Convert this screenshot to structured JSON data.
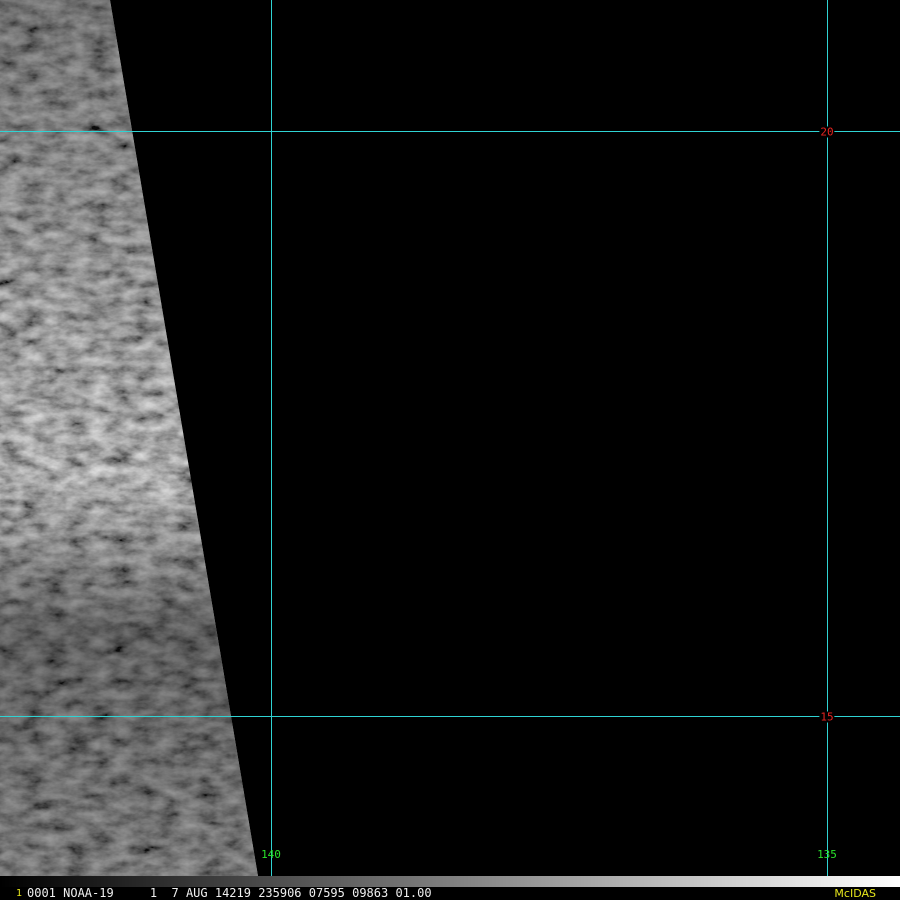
{
  "map": {
    "latitude_lines": [
      {
        "label": "20"
      },
      {
        "label": "15"
      }
    ],
    "longitude_lines": [
      {
        "label": "140"
      },
      {
        "label": "135"
      }
    ],
    "grid_color": "#2fd3d3",
    "lat_label_color": "#e8231f",
    "lon_label_color": "#29e22b"
  },
  "status_bar": {
    "frame_number": "1",
    "info": "0001 NOAA-19     1  7 AUG 14219 235906 07595 09863 01.00",
    "brand": "McIDAS"
  }
}
